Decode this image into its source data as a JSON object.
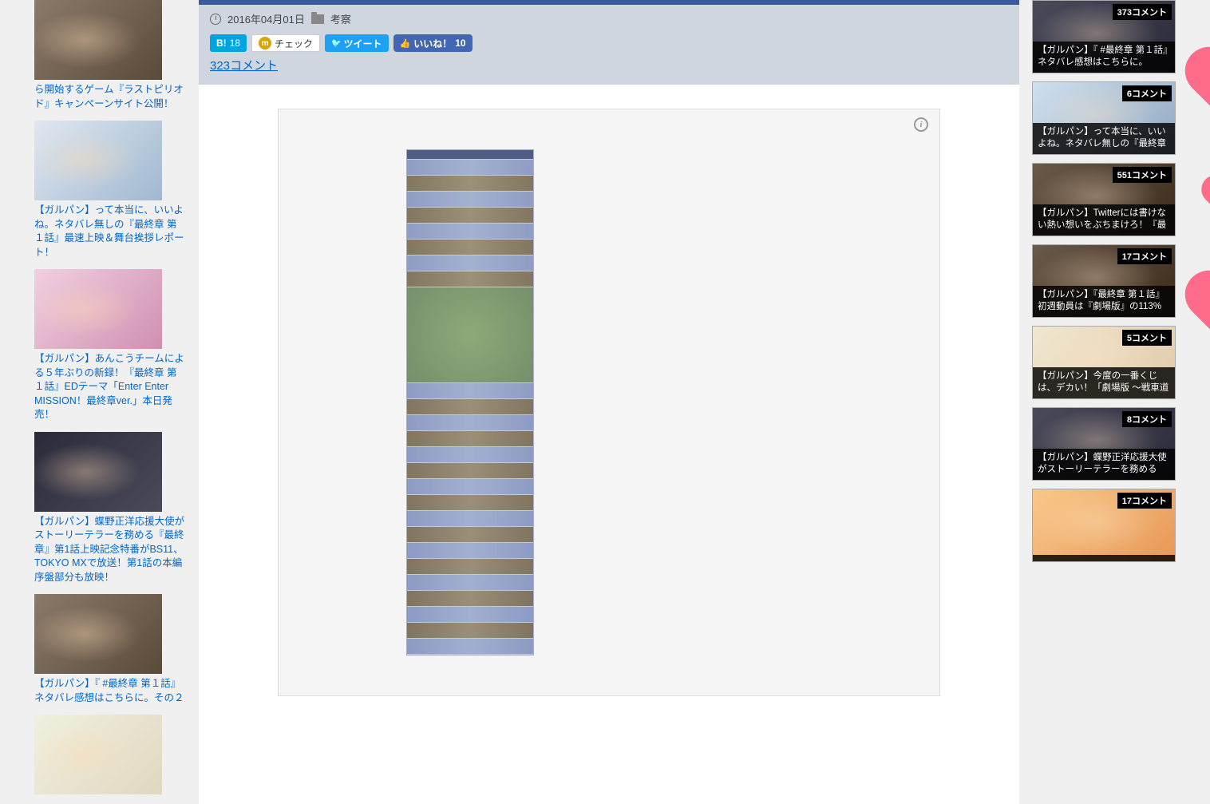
{
  "article": {
    "date": "2016年04月01日",
    "category": "考察",
    "comment_count": "323コメント",
    "share": {
      "hatena_label": "B!",
      "hatena_count": "18",
      "mixi_label": "チェック",
      "twitter_label": "ツイート",
      "fb_label": "いいね！",
      "fb_count": "10"
    }
  },
  "left_sidebar": [
    {
      "title": "ら開始するゲーム『ラストピリオド』キャンペーンサイト公開！",
      "thumb_class": ""
    },
    {
      "title": "【ガルパン】って本当に、いいよね。ネタバレ無しの『最終章 第１話』最速上映＆舞台挨拶レポート！",
      "thumb_class": "blue"
    },
    {
      "title": "【ガルパン】あんこうチームによる５年ぶりの新録！『最終章 第１話』EDテーマ「Enter Enter MISSION！最終章ver.」本日発売！",
      "thumb_class": "pink"
    },
    {
      "title": "【ガルパン】蝶野正洋応援大使がストーリーテラーを務める『最終章』第1話上映記念特番がBS11、TOKYO MXで放送！第1話の本編序盤部分も放映！",
      "thumb_class": "dark"
    },
    {
      "title": "【ガルパン】『 #最終章 第１話』ネタバレ感想はこちらに。その２",
      "thumb_class": ""
    },
    {
      "title": "",
      "thumb_class": "light"
    }
  ],
  "right_sidebar": [
    {
      "comments": "373コメント",
      "caption": "【ガルパン】『 #最終章 第１話』ネタバレ感想はこちらに。",
      "thumb_class": ""
    },
    {
      "comments": "6コメント",
      "caption": "【ガルパン】って本当に、いいよね。ネタバレ無しの『最終章",
      "thumb_class": "blue"
    },
    {
      "comments": "551コメント",
      "caption": "【ガルパン】Twitterには書けない熱い想いをぶちまけろ！『最",
      "thumb_class": "brown"
    },
    {
      "comments": "17コメント",
      "caption": "【ガルパン】『最終章 第１話』初週動員は『劇場版』の113%",
      "thumb_class": "brown"
    },
    {
      "comments": "5コメント",
      "caption": "【ガルパン】今度の一番くじは、デカい！「劇場版 ～戦車道",
      "thumb_class": "pink"
    },
    {
      "comments": "8コメント",
      "caption": "【ガルパン】蝶野正洋応援大使がストーリーテラーを務める",
      "thumb_class": ""
    },
    {
      "comments": "17コメント",
      "caption": "",
      "thumb_class": "bright"
    }
  ]
}
